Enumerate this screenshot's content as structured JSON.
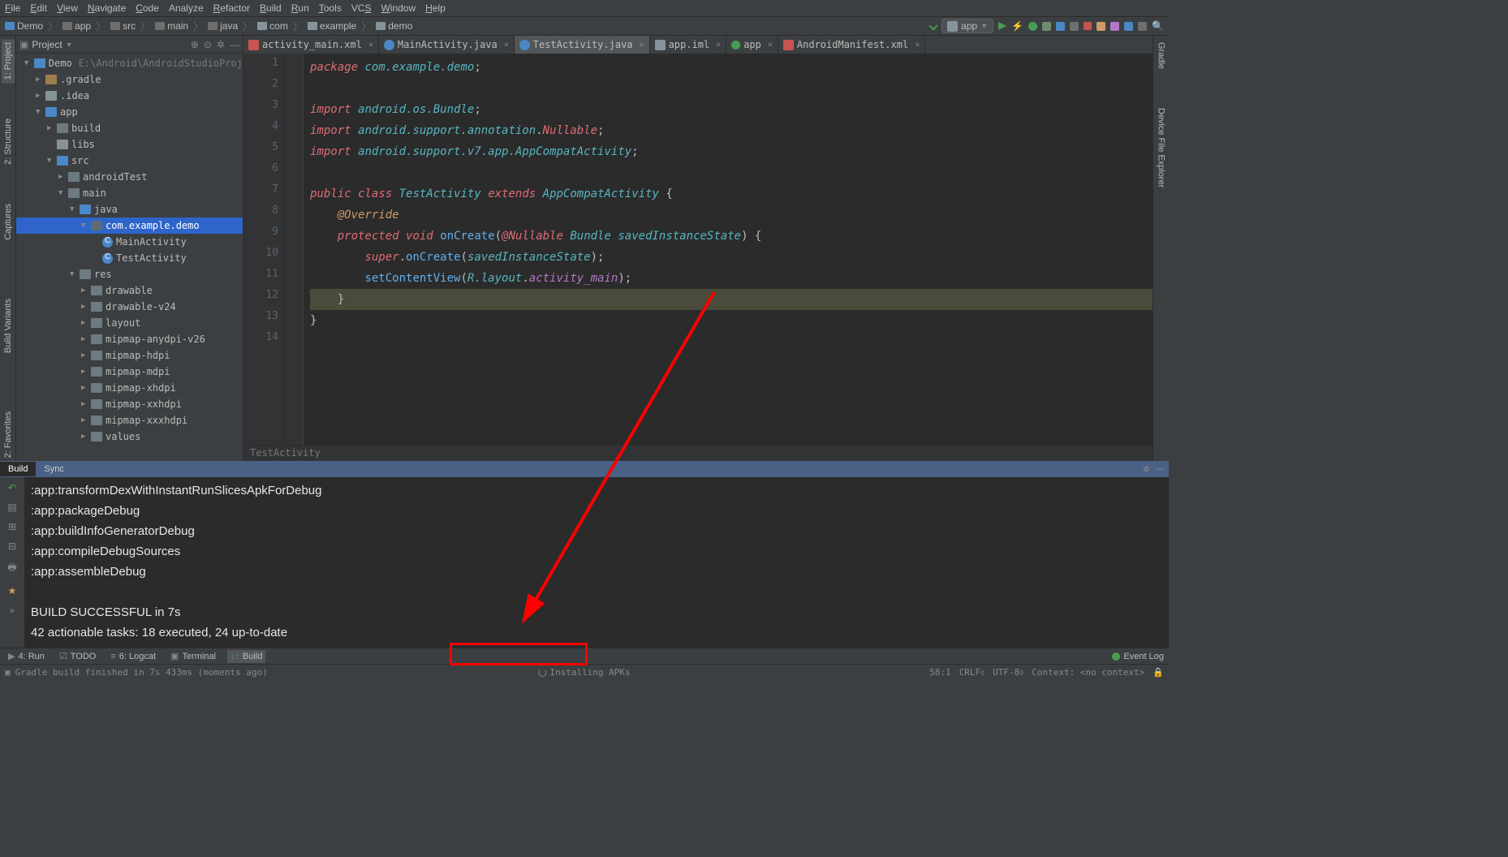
{
  "menu": [
    "File",
    "Edit",
    "View",
    "Navigate",
    "Code",
    "Analyze",
    "Refactor",
    "Build",
    "Run",
    "Tools",
    "VCS",
    "Window",
    "Help"
  ],
  "menu_underline": [
    "F",
    "E",
    "V",
    "N",
    "C",
    "",
    "R",
    "B",
    "R",
    "T",
    "S",
    "W",
    "H"
  ],
  "breadcrumb": [
    "Demo",
    "app",
    "src",
    "main",
    "java",
    "com",
    "example",
    "demo"
  ],
  "run_config": "app",
  "project_panel_title": "Project",
  "tree": [
    {
      "depth": 0,
      "arrow": "▼",
      "icon": "folder-blue",
      "label": "Demo",
      "path": "E:\\Android\\AndroidStudioProj"
    },
    {
      "depth": 1,
      "arrow": "▶",
      "icon": "folder-brown",
      "label": ".gradle"
    },
    {
      "depth": 1,
      "arrow": "▶",
      "icon": "folder",
      "label": ".idea"
    },
    {
      "depth": 1,
      "arrow": "▼",
      "icon": "folder-blue",
      "label": "app"
    },
    {
      "depth": 2,
      "arrow": "▶",
      "icon": "folder-o",
      "label": "build"
    },
    {
      "depth": 2,
      "arrow": "",
      "icon": "folder",
      "label": "libs"
    },
    {
      "depth": 2,
      "arrow": "▼",
      "icon": "folder-blue",
      "label": "src"
    },
    {
      "depth": 3,
      "arrow": "▶",
      "icon": "folder-o",
      "label": "androidTest"
    },
    {
      "depth": 3,
      "arrow": "▼",
      "icon": "folder-o",
      "label": "main"
    },
    {
      "depth": 4,
      "arrow": "▼",
      "icon": "folder-blue",
      "label": "java"
    },
    {
      "depth": 5,
      "arrow": "▼",
      "icon": "folder-pkg",
      "label": "com.example.demo",
      "selected": true
    },
    {
      "depth": 6,
      "arrow": "",
      "icon": "class",
      "label": "MainActivity"
    },
    {
      "depth": 6,
      "arrow": "",
      "icon": "class",
      "label": "TestActivity"
    },
    {
      "depth": 4,
      "arrow": "▼",
      "icon": "folder-o",
      "label": "res"
    },
    {
      "depth": 5,
      "arrow": "▶",
      "icon": "folder-o",
      "label": "drawable"
    },
    {
      "depth": 5,
      "arrow": "▶",
      "icon": "folder-o",
      "label": "drawable-v24"
    },
    {
      "depth": 5,
      "arrow": "▶",
      "icon": "folder-o",
      "label": "layout"
    },
    {
      "depth": 5,
      "arrow": "▶",
      "icon": "folder-o",
      "label": "mipmap-anydpi-v26"
    },
    {
      "depth": 5,
      "arrow": "▶",
      "icon": "folder-o",
      "label": "mipmap-hdpi"
    },
    {
      "depth": 5,
      "arrow": "▶",
      "icon": "folder-o",
      "label": "mipmap-mdpi"
    },
    {
      "depth": 5,
      "arrow": "▶",
      "icon": "folder-o",
      "label": "mipmap-xhdpi"
    },
    {
      "depth": 5,
      "arrow": "▶",
      "icon": "folder-o",
      "label": "mipmap-xxhdpi"
    },
    {
      "depth": 5,
      "arrow": "▶",
      "icon": "folder-o",
      "label": "mipmap-xxxhdpi"
    },
    {
      "depth": 5,
      "arrow": "▶",
      "icon": "folder-o",
      "label": "values"
    }
  ],
  "file_tabs": [
    {
      "icon": "xml",
      "label": "activity_main.xml"
    },
    {
      "icon": "java",
      "label": "MainActivity.java"
    },
    {
      "icon": "java",
      "label": "TestActivity.java",
      "active": true
    },
    {
      "icon": "mod",
      "label": "app.iml"
    },
    {
      "icon": "and",
      "label": "app"
    },
    {
      "icon": "xml",
      "label": "AndroidManifest.xml"
    }
  ],
  "code": {
    "lines": [
      {
        "n": 1,
        "html": "<span class='kw'>package</span> <span class='pkg-path'>com.example.demo</span><span class='punct'>;</span>"
      },
      {
        "n": 2,
        "html": ""
      },
      {
        "n": 3,
        "html": "<span class='imp'>import</span> <span class='pkg-path'>android.os.Bundle</span><span class='punct'>;</span>"
      },
      {
        "n": 4,
        "html": "<span class='imp'>import</span> <span class='pkg-path'>android.support.annotation</span><span class='punct'>.</span><span class='ann-ref'>Nullable</span><span class='punct'>;</span>"
      },
      {
        "n": 5,
        "html": "<span class='imp'>import</span> <span class='pkg-path'>android.support.v7.app.AppCompatActivity</span><span class='punct'>;</span>"
      },
      {
        "n": 6,
        "html": ""
      },
      {
        "n": 7,
        "html": "<span class='kw'>public class</span> <span class='cls'>TestActivity</span> <span class='kw'>extends</span> <span class='cls'>AppCompatActivity</span> <span class='punct'>{</span>"
      },
      {
        "n": 8,
        "html": "    <span class='ann'>@Override</span>"
      },
      {
        "n": 9,
        "html": "    <span class='kw'>protected void</span> <span class='mth'>onCreate</span><span class='punct'>(</span><span class='ann-ref'>@Nullable</span> <span class='cls'>Bundle</span> <span class='param'>savedInstanceState</span><span class='punct'>) {</span>"
      },
      {
        "n": 10,
        "html": "        <span class='kw'>super</span><span class='punct'>.</span><span class='mth'>onCreate</span><span class='punct'>(</span><span class='param'>savedInstanceState</span><span class='punct'>);</span>"
      },
      {
        "n": 11,
        "html": "        <span class='mth'>setContentView</span><span class='punct'>(</span><span class='cls'>R.layout</span><span class='punct'>.</span><span class='ref-dim'>activity_main</span><span class='punct'>);</span>"
      },
      {
        "n": 12,
        "html": "    <span class='punct'>}</span>",
        "hl": true
      },
      {
        "n": 13,
        "html": "<span class='punct'>}</span>"
      },
      {
        "n": 14,
        "html": ""
      }
    ],
    "breadcrumb": "TestActivity"
  },
  "build_tabs": [
    "Build",
    "Sync"
  ],
  "build_output": [
    ":app:transformDexWithInstantRunSlicesApkForDebug",
    ":app:packageDebug",
    ":app:buildInfoGeneratorDebug",
    ":app:compileDebugSources",
    ":app:assembleDebug",
    "",
    "BUILD SUCCESSFUL in 7s",
    "42 actionable tasks: 18 executed, 24 up-to-date"
  ],
  "bottom_tabs": [
    {
      "icon": "▶",
      "label": "4: Run"
    },
    {
      "icon": "☑",
      "label": "TODO"
    },
    {
      "icon": "≡",
      "label": "6: Logcat"
    },
    {
      "icon": "▣",
      "label": "Terminal"
    },
    {
      "icon": "↓↑",
      "label": "Build",
      "active": true
    }
  ],
  "event_log": "Event Log",
  "status": {
    "left": "Gradle build finished in 7s 433ms (moments ago)",
    "center": "Installing APKs",
    "right": [
      "58:1",
      "CRLF⬨",
      "UTF-8⬨",
      "Context: <no context>"
    ]
  },
  "left_tabs": [
    "1: Project",
    "2: Structure",
    "Captures"
  ],
  "left_tabs2": [
    "Build Variants",
    "2: Favorites"
  ],
  "right_tabs": [
    "Gradle",
    "Device File Explorer"
  ]
}
